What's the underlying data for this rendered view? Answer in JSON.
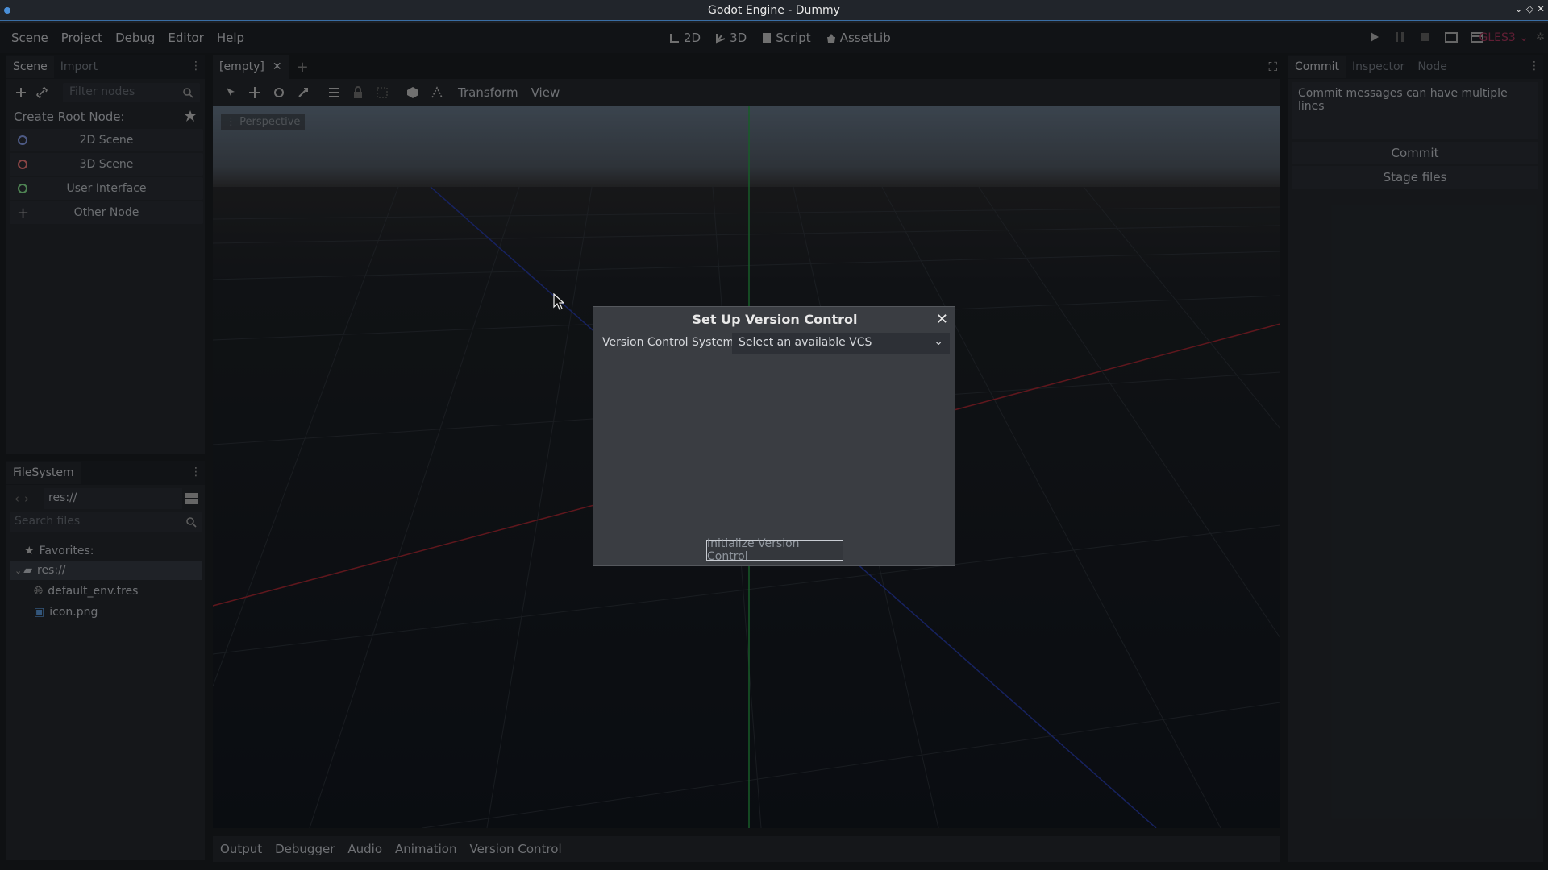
{
  "window": {
    "title": "Godot Engine - Dummy"
  },
  "menubar": {
    "items": [
      "Scene",
      "Project",
      "Debug",
      "Editor",
      "Help"
    ],
    "modes": [
      "2D",
      "3D",
      "Script",
      "AssetLib"
    ],
    "renderer": "GLES3"
  },
  "scene_dock": {
    "tabs": [
      "Scene",
      "Import"
    ],
    "filter_placeholder": "Filter nodes",
    "create_root_label": "Create Root Node:",
    "buttons": [
      "2D Scene",
      "3D Scene",
      "User Interface",
      "Other Node"
    ]
  },
  "filesystem_dock": {
    "title": "FileSystem",
    "path": "res://",
    "search_placeholder": "Search files",
    "tree": {
      "favorites": "Favorites:",
      "root": "res://",
      "files": [
        "default_env.tres",
        "icon.png"
      ]
    }
  },
  "editor": {
    "scene_tab": "[empty]",
    "toolbar_menus": [
      "Transform",
      "View"
    ],
    "viewport_label": "Perspective"
  },
  "bottom_panel": {
    "tabs": [
      "Output",
      "Debugger",
      "Audio",
      "Animation",
      "Version Control"
    ]
  },
  "right_dock": {
    "tabs": [
      "Commit",
      "Inspector",
      "Node"
    ],
    "commit_placeholder": "Commit messages can have multiple lines",
    "commit_button": "Commit",
    "stage_button": "Stage files"
  },
  "dialog": {
    "title": "Set Up Version Control",
    "vcs_label": "Version Control System",
    "vcs_select": "Select an available VCS",
    "init_button": "Initialize Version Control"
  },
  "colors": {
    "accent": "#3a6ea5",
    "renderer": "#b0385f",
    "axis_x": "#b02a35",
    "axis_y": "#2aa84a",
    "axis_z": "#2a3fb0"
  }
}
